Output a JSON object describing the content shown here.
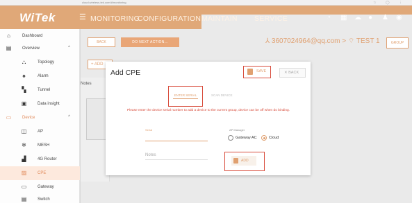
{
  "browser": {
    "url": "cloud.wireless-tek.com/#/monitoring"
  },
  "header": {
    "logo": "WiTek",
    "nav": [
      "MONITORING",
      "CONFIGURATION",
      "MAINTAIN",
      "SERVICE"
    ]
  },
  "sidebar": {
    "items": [
      {
        "label": "Dashboard",
        "icon": "home-icon"
      },
      {
        "label": "Overview",
        "icon": "overview-icon"
      },
      {
        "label": "Topology",
        "icon": "topology-icon"
      },
      {
        "label": "Alarm",
        "icon": "bell-icon"
      },
      {
        "label": "Tunnel",
        "icon": "tunnel-icon"
      },
      {
        "label": "Data insight",
        "icon": "chart-icon"
      },
      {
        "label": "Device",
        "icon": "device-icon"
      },
      {
        "label": "AP",
        "icon": "ap-icon"
      },
      {
        "label": "MESH",
        "icon": "mesh-icon"
      },
      {
        "label": "4G Router",
        "icon": "router-icon"
      },
      {
        "label": "CPE",
        "icon": "cpe-icon"
      },
      {
        "label": "Gateway",
        "icon": "gateway-icon"
      },
      {
        "label": "Switch",
        "icon": "switch-icon"
      }
    ]
  },
  "toolbar": {
    "back_label": "BACK",
    "next_label": "DO NEXT ACTION...",
    "account": "3607024964@qq.com",
    "group_name": "TEST 1",
    "group_button": "GROUP"
  },
  "background": {
    "add_label": "+ ADD",
    "notes_label": "Notes"
  },
  "modal": {
    "title": "Add CPE",
    "save_label": "SAVE",
    "back_label": "BACK",
    "tab_enter_serial": "ENTER SERIAL",
    "tab_scan": "SCAN DEVICE",
    "instructions": "Please enter the device serial number to add a device to the current group, device can be off when do binding.",
    "serial_label": "Serial",
    "serial_value": "",
    "notes_label": "Notes",
    "mgmt_label": "AP Manager",
    "option_gateway": "Gateway AC",
    "option_cloud": "Cloud",
    "add_label": "ADD"
  },
  "colors": {
    "accent": "#e0a070",
    "highlight": "#d84b3b",
    "header": "#e0a878"
  }
}
